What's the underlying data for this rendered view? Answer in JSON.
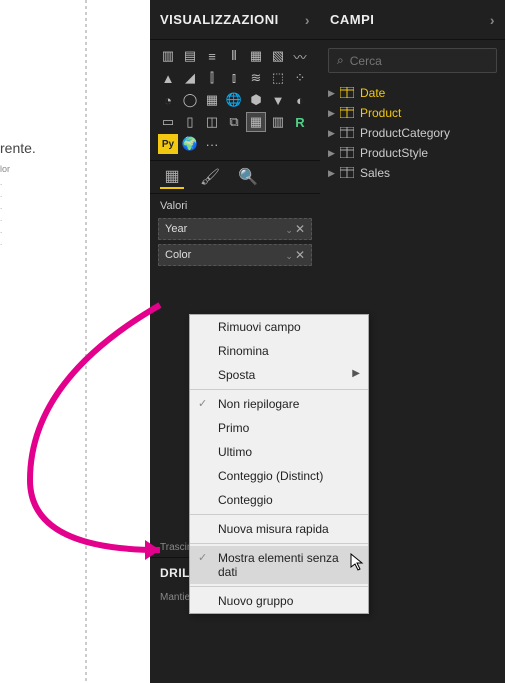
{
  "canvas": {
    "text_fragment": "rente.",
    "label_fragment": "lor",
    "rows": [
      ".",
      ".",
      ".",
      ".",
      ".",
      "."
    ]
  },
  "viz_panel": {
    "title": "VISUALIZZAZIONI",
    "sections": {
      "values_label": "Valori",
      "fields": [
        {
          "name": "Year"
        },
        {
          "name": "Color"
        }
      ],
      "drag_hint": "Trascinare qui i campi dati",
      "drill_title": "DRILL-THROUGH",
      "drill_hint": "Mantieni tutti i filtri"
    }
  },
  "fields_panel": {
    "title": "CAMPI",
    "search_placeholder": "Cerca",
    "tables": [
      {
        "name": "Date",
        "selected": true
      },
      {
        "name": "Product",
        "selected": true
      },
      {
        "name": "ProductCategory",
        "selected": false
      },
      {
        "name": "ProductStyle",
        "selected": false
      },
      {
        "name": "Sales",
        "selected": false
      }
    ]
  },
  "context_menu": {
    "items": [
      {
        "label": "Rimuovi campo",
        "type": "item"
      },
      {
        "label": "Rinomina",
        "type": "item"
      },
      {
        "label": "Sposta",
        "type": "submenu"
      },
      {
        "type": "sep"
      },
      {
        "label": "Non riepilogare",
        "type": "check",
        "checked": true
      },
      {
        "label": "Primo",
        "type": "item"
      },
      {
        "label": "Ultimo",
        "type": "item"
      },
      {
        "label": "Conteggio (Distinct)",
        "type": "item"
      },
      {
        "label": "Conteggio",
        "type": "item"
      },
      {
        "type": "sep"
      },
      {
        "label": "Nuova misura rapida",
        "type": "item"
      },
      {
        "type": "sep"
      },
      {
        "label": "Mostra elementi senza dati",
        "type": "check",
        "checked": true,
        "hover": true
      },
      {
        "type": "sep"
      },
      {
        "label": "Nuovo gruppo",
        "type": "item"
      }
    ]
  }
}
